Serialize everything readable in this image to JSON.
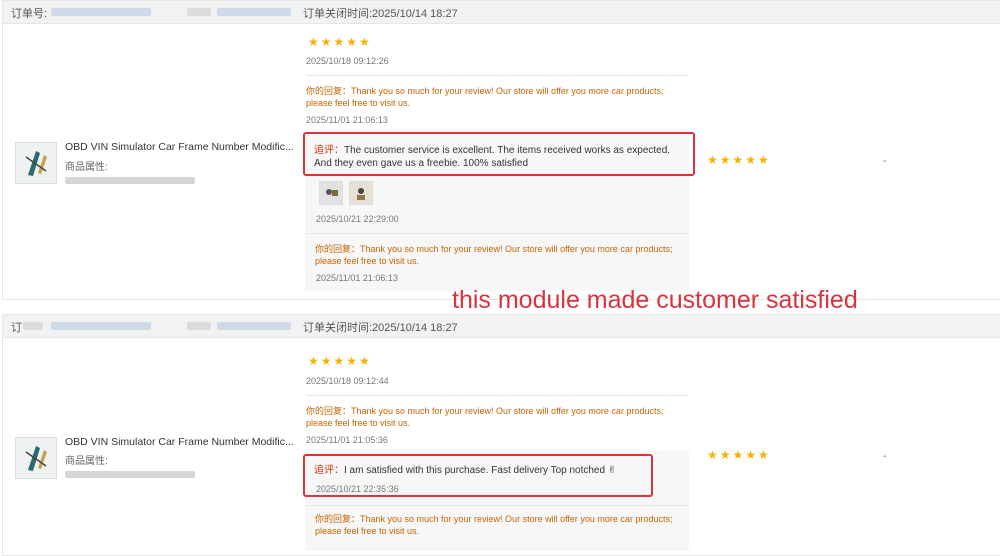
{
  "orders": [
    {
      "order_no_label": "订单号:",
      "close_time": "订单关闭时间:2025/10/14 18:27",
      "product_name": "OBD VIN Simulator Car Frame Number Modific...",
      "attr_label": "商品属性:",
      "review_date": "2025/10/18 09:12:26",
      "reply1": "你的回复：Thank you so much for your review! Our store will offer you more car products; please feel free to visit us.",
      "reply1_date": "2025/11/01 21:06:13",
      "additional_label": "追评：",
      "additional_text": "The customer service is excellent. The items received works as expected. And they even gave us a freebie. 100% satisfied",
      "additional_date": "2025/10/21 22:29:00",
      "reply2": "你的回复：Thank you so much for your review! Our store will offer you more car products; please feel free to visit us.",
      "reply2_date": "2025/11/01 21:06:13",
      "stars": "★★★★★",
      "rating": 5,
      "dash": "-"
    },
    {
      "order_no_label": "订",
      "close_time": "订单关闭时间:2025/10/14 18:27",
      "product_name": "OBD VIN Simulator Car Frame Number Modific...",
      "attr_label": "商品属性:",
      "review_date": "2025/10/18 09:12:44",
      "reply1": "你的回复：Thank you so much for your review! Our store will offer you more car products; please feel free to visit us.",
      "reply1_date": "2025/11/01 21:05:36",
      "additional_label": "追评：",
      "additional_text": "I am satisfied with this purchase. Fast delivery Top notched ✌",
      "additional_date": "2025/10/21 22:35:36",
      "reply2": "你的回复：Thank you so much for your review! Our store will offer you more car products; please feel free to visit us.",
      "stars": "★★★★★",
      "rating": 5,
      "dash": "-"
    }
  ],
  "annotation": "this module made customer satisfied",
  "colors": {
    "star": "#f5b301",
    "reply": "#c86400",
    "highlight_box": "#d9333f",
    "annotation": "#d9333f"
  }
}
